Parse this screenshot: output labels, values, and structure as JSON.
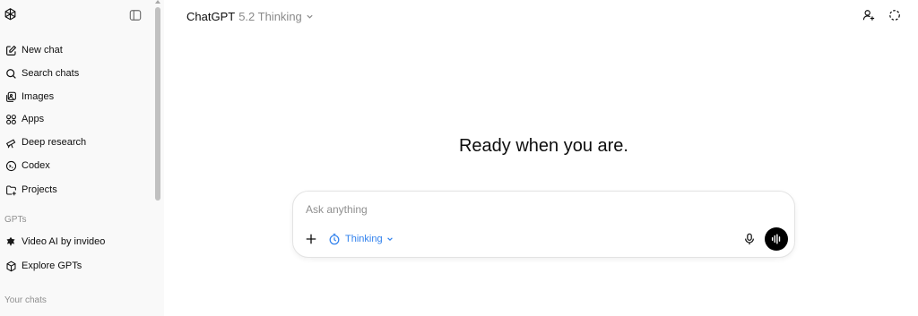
{
  "header": {
    "model_name": "ChatGPT",
    "model_version": "5.2 Thinking"
  },
  "sidebar": {
    "items": [
      {
        "label": "New chat",
        "icon": "new-chat-icon"
      },
      {
        "label": "Search chats",
        "icon": "search-icon"
      },
      {
        "label": "Images",
        "icon": "images-icon"
      },
      {
        "label": "Apps",
        "icon": "apps-icon"
      },
      {
        "label": "Deep research",
        "icon": "telescope-icon"
      },
      {
        "label": "Codex",
        "icon": "codex-icon"
      },
      {
        "label": "Projects",
        "icon": "folder-icon"
      }
    ],
    "gpts_label": "GPTs",
    "gpts": [
      {
        "label": "Video AI by invideo",
        "icon": "invideo-icon"
      },
      {
        "label": "Explore GPTs",
        "icon": "cube-icon"
      }
    ],
    "your_chats_label": "Your chats"
  },
  "main": {
    "headline": "Ready when you are.",
    "composer": {
      "placeholder": "Ask anything",
      "mode_label": "Thinking"
    }
  },
  "colors": {
    "sidebar_bg": "#f9f9f9",
    "accent_blue": "#2f80ed",
    "voice_button": "#000000"
  }
}
